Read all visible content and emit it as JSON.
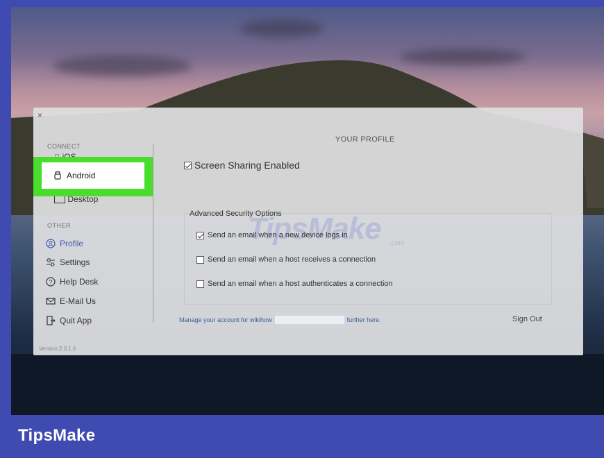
{
  "window": {
    "close_symbol": "×",
    "version": "Version 2.3.1.6"
  },
  "sidebar": {
    "connect_label": "CONNECT",
    "connect_items": [
      {
        "label": "iOS",
        "icon": "apple-icon"
      },
      {
        "label": "Android",
        "icon": "android-icon"
      },
      {
        "label": "Desktop",
        "icon": "desktop-icon"
      }
    ],
    "other_label": "OTHER",
    "other_items": [
      {
        "label": "Profile",
        "icon": "profile-icon",
        "active": true
      },
      {
        "label": "Settings",
        "icon": "settings-icon"
      },
      {
        "label": "Help Desk",
        "icon": "help-icon"
      },
      {
        "label": "E-Mail Us",
        "icon": "mail-icon"
      },
      {
        "label": "Quit App",
        "icon": "quit-icon"
      }
    ]
  },
  "profile": {
    "title": "YOUR PROFILE",
    "screen_sharing": {
      "label": "Screen Sharing Enabled",
      "checked": true
    },
    "advanced_title": "Advanced Security Options",
    "options": [
      {
        "label": "Send an email when a new device logs in",
        "checked": true
      },
      {
        "label": "Send an email when a host receives a connection",
        "checked": false
      },
      {
        "label": "Send an email when a host authenticates a connection",
        "checked": false
      }
    ],
    "manage_prefix": "Manage your account for wikihow",
    "manage_suffix": "further here.",
    "sign_out": "Sign Out"
  },
  "watermark": {
    "text": "TipsMake",
    "suffix": ".com"
  },
  "brand": {
    "name": "TipsMake"
  },
  "colors": {
    "highlight": "#49dd2c",
    "brand_bar": "#3f4bb0",
    "link": "#3a5aa0"
  }
}
